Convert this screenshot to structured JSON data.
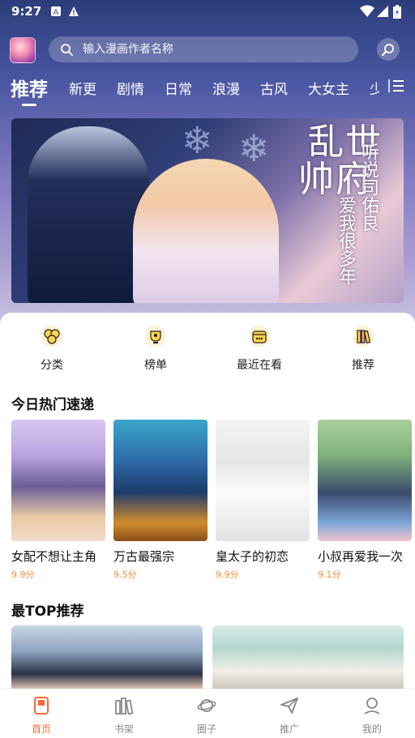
{
  "status_bar": {
    "time": "9:27"
  },
  "search": {
    "placeholder": "输入漫画作者名称"
  },
  "tabs": [
    {
      "label": "推荐",
      "active": true
    },
    {
      "label": "新更"
    },
    {
      "label": "剧情"
    },
    {
      "label": "日常"
    },
    {
      "label": "浪漫"
    },
    {
      "label": "古风"
    },
    {
      "label": "大女主"
    },
    {
      "label": "少"
    }
  ],
  "banner": {
    "title_line1": "乱世",
    "title_line2": "帅府",
    "subtitle_col1": "听说司佑良",
    "subtitle_col2": "爱我很多年"
  },
  "quick_actions": [
    {
      "label": "分类",
      "icon": "category-icon"
    },
    {
      "label": "榜单",
      "icon": "ranking-icon"
    },
    {
      "label": "最近在看",
      "icon": "recent-icon"
    },
    {
      "label": "推荐",
      "icon": "recommend-icon"
    }
  ],
  "sections": {
    "hot_today": "今日热门速递",
    "top": "最TOP推荐"
  },
  "hot_comics": [
    {
      "title": "女配不想让主角",
      "score": "9.9分"
    },
    {
      "title": "万古最强宗",
      "score": "9.5分"
    },
    {
      "title": "皇太子的初恋",
      "score": "9.9分"
    },
    {
      "title": "小叔再爱我一次",
      "score": "9.1分"
    }
  ],
  "bottom_nav": [
    {
      "label": "首页",
      "active": true,
      "icon": "home-icon"
    },
    {
      "label": "书架",
      "icon": "bookshelf-icon"
    },
    {
      "label": "圈子",
      "icon": "planet-icon"
    },
    {
      "label": "推广",
      "icon": "paper-plane-icon"
    },
    {
      "label": "我的",
      "icon": "profile-icon"
    }
  ],
  "colors": {
    "accent": "#f56b3a",
    "score": "#ff8a3d"
  }
}
